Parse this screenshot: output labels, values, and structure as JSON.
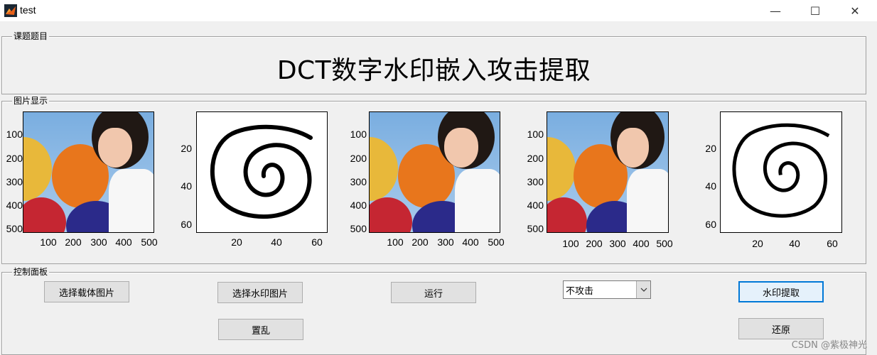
{
  "window": {
    "title": "test",
    "minimize": "—",
    "maximize": "☐",
    "close": "✕"
  },
  "panels": {
    "title_panel_label": "课题题目",
    "title_text": "DCT数字水印嵌入攻击提取",
    "images_panel_label": "图片显示",
    "control_panel_label": "控制面板"
  },
  "axes_ticks": {
    "photo_y": [
      "100",
      "200",
      "300",
      "400",
      "500"
    ],
    "photo_x": [
      "100",
      "200",
      "300",
      "400",
      "500"
    ],
    "mark_y": [
      "20",
      "40",
      "60"
    ],
    "mark_x": [
      "20",
      "40",
      "60"
    ]
  },
  "controls": {
    "select_carrier": "选择载体图片",
    "select_watermark": "选择水印图片",
    "run": "运行",
    "attack_selected": "不攻击",
    "extract": "水印提取",
    "scramble": "置乱",
    "restore": "还原"
  },
  "watermark_text": "CSDN @紫极神光",
  "colors": {
    "focus": "#0078d7",
    "button_bg": "#e1e1e1"
  },
  "icons": {
    "app": "matlab-icon",
    "dropdown": "chevron-down-icon"
  }
}
